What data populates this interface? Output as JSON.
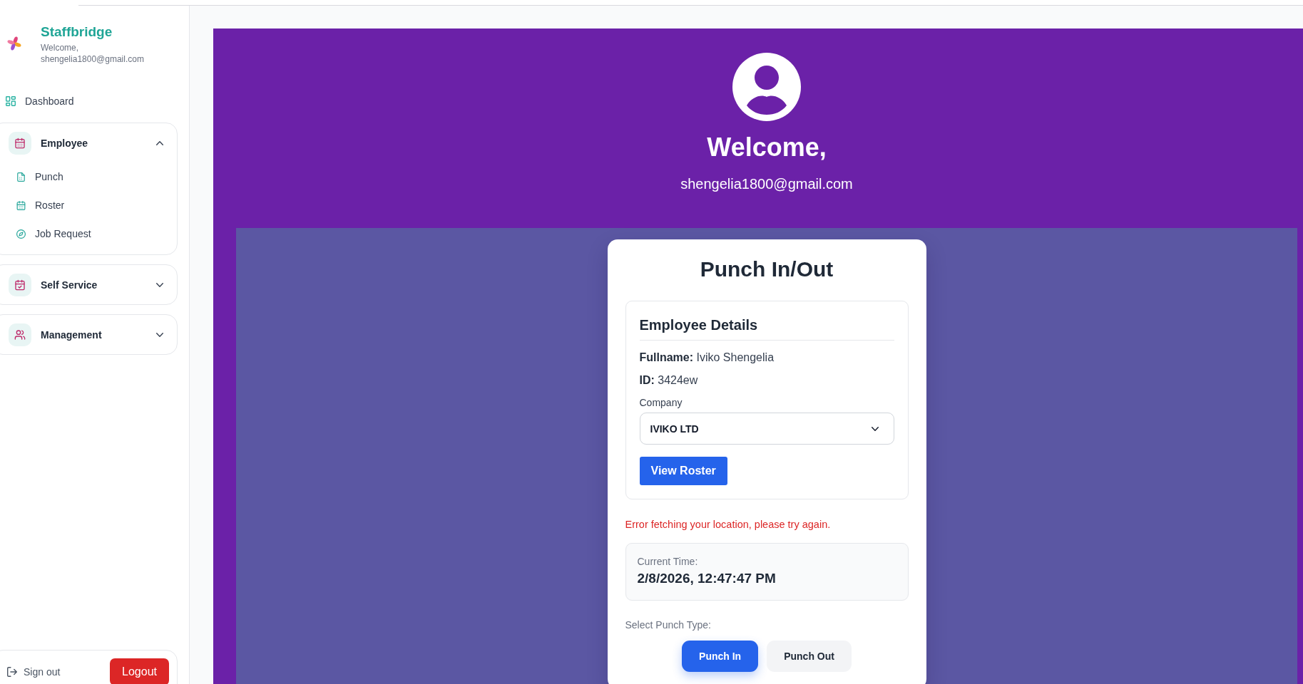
{
  "sidebar": {
    "brand": {
      "name": "Staffbridge",
      "greeting": "Welcome,",
      "email": "shengelia1800@gmail.com"
    },
    "links": [
      {
        "label": "Dashboard"
      }
    ],
    "groups": [
      {
        "label": "Employee",
        "expanded": true,
        "children": [
          {
            "label": "Punch"
          },
          {
            "label": "Roster"
          },
          {
            "label": "Job Request"
          }
        ]
      },
      {
        "label": "Self Service",
        "expanded": false
      },
      {
        "label": "Management",
        "expanded": false
      }
    ],
    "footer": {
      "sign_out": "Sign out",
      "logout_button": "Logout"
    }
  },
  "header": {
    "title": "Welcome,",
    "email": "shengelia1800@gmail.com"
  },
  "punch_card": {
    "title": "Punch In/Out",
    "employee_details": {
      "heading": "Employee Details",
      "fullname": "**Fullname:** Iviko Shengelia",
      "id": "**ID:** 3424ew",
      "company": {
        "label": "Company",
        "value": "IVIKO LTD"
      },
      "view_roster_button": "View Roster"
    },
    "error": "Error fetching your location, please try again.",
    "current_time": {
      "label": "Current Time:",
      "value": "2/8/2026, 12:47:47 PM"
    },
    "punch_type": {
      "label": "Select Punch Type:",
      "options": [
        {
          "label": "Punch In",
          "selected": true
        },
        {
          "label": "Punch Out",
          "selected": false
        }
      ]
    }
  }
}
